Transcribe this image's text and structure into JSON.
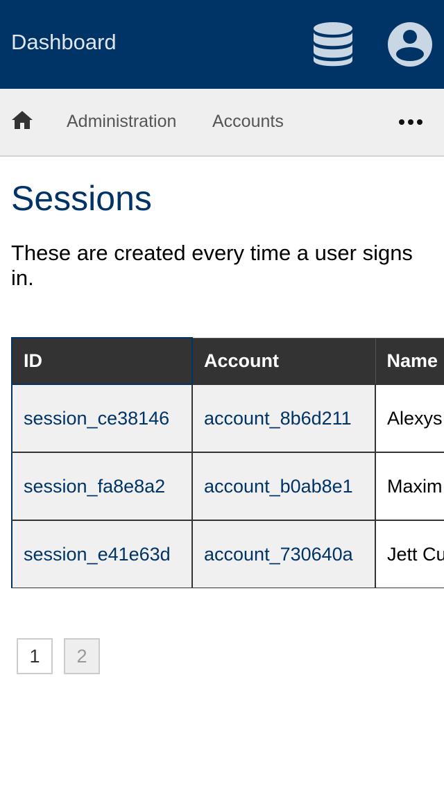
{
  "header": {
    "title": "Dashboard",
    "db_icon": "database-icon",
    "user_icon": "user-circle-icon",
    "bg_color": "#003366"
  },
  "nav": {
    "home_icon": "home-icon",
    "items": [
      {
        "label": "Administration"
      },
      {
        "label": "Accounts"
      }
    ],
    "more_icon": "ellipsis-icon"
  },
  "page": {
    "title": "Sessions",
    "description": "These are created every time a user signs in."
  },
  "table": {
    "columns": [
      "ID",
      "Account",
      "Name"
    ],
    "rows": [
      {
        "id": "session_ce38146",
        "account": "account_8b6d211",
        "name": "Alexys Stroma"
      },
      {
        "id": "session_fa8e8a2",
        "account": "account_b0ab8e1",
        "name": "Maxim Feest"
      },
      {
        "id": "session_e41e63d",
        "account": "account_730640a",
        "name": "Jett Cumm"
      }
    ]
  },
  "pagination": {
    "pages": [
      "1",
      "2"
    ],
    "current": "2"
  }
}
